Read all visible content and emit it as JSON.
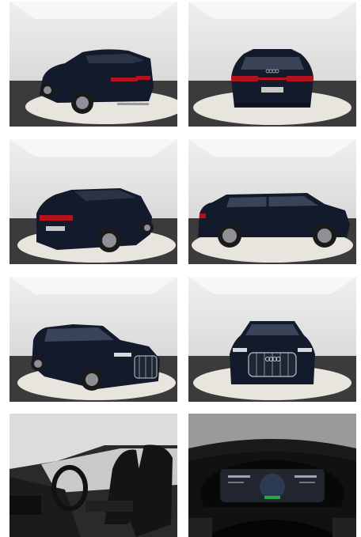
{
  "gallery": {
    "photos": [
      {
        "id": "photo-1",
        "subject": "rear-left-three-quarter"
      },
      {
        "id": "photo-2",
        "subject": "rear"
      },
      {
        "id": "photo-3",
        "subject": "rear-left-three-quarter-close"
      },
      {
        "id": "photo-4",
        "subject": "left-side-profile"
      },
      {
        "id": "photo-5",
        "subject": "front-left-three-quarter"
      },
      {
        "id": "photo-6",
        "subject": "front"
      },
      {
        "id": "photo-7",
        "subject": "interior-front-seats"
      },
      {
        "id": "photo-8",
        "subject": "digital-instrument-cluster"
      }
    ],
    "colors": {
      "car_body": "#121a2b",
      "studio_wall": "#d8d8d8",
      "studio_floor": "#3a3a3a",
      "turntable": "#e6e4dc",
      "taillight": "#b3121e",
      "interior": "#1b1b1d"
    }
  }
}
